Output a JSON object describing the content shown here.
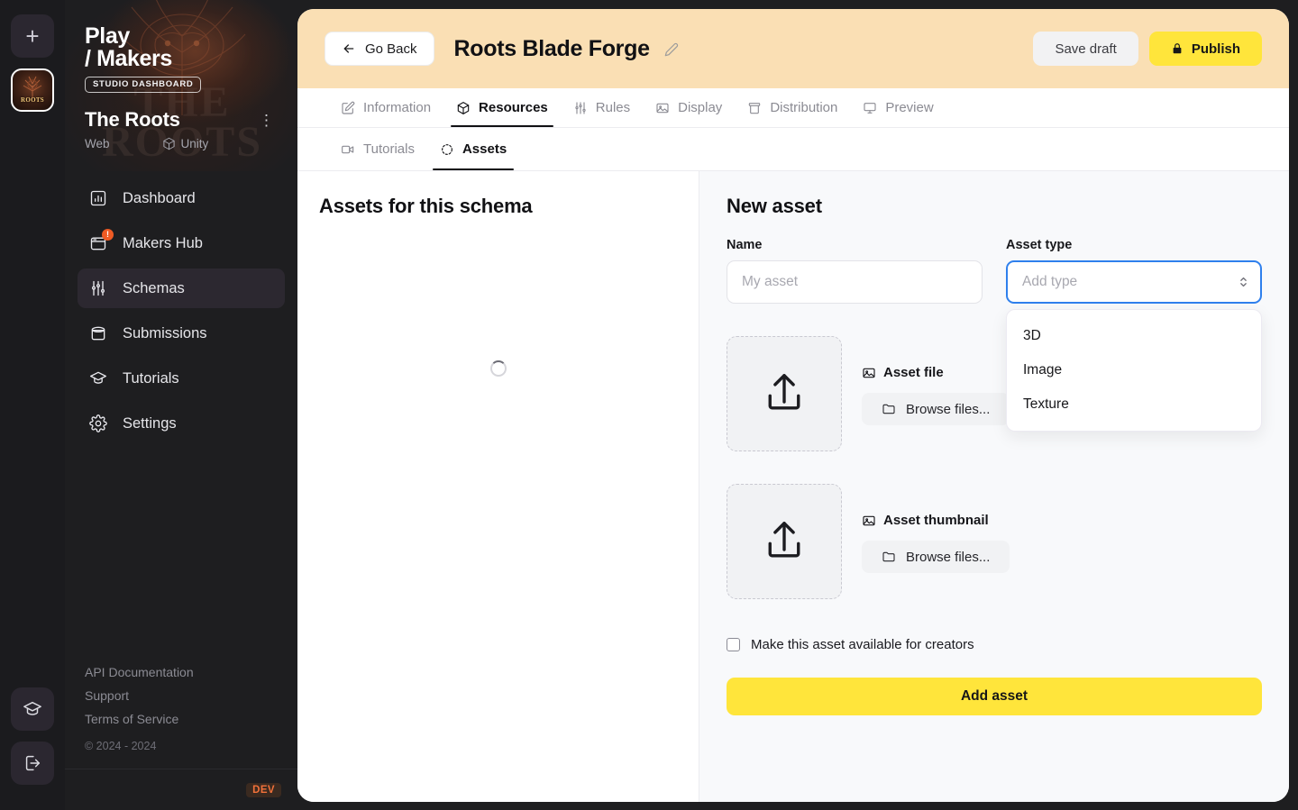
{
  "rail": {
    "add_label": "+",
    "avatar_label": "ROOTS",
    "tutorials_icon_name": "graduation-cap-icon",
    "logout_icon_name": "logout-icon"
  },
  "sidebar": {
    "brand_line1": "Play",
    "brand_line2": "/ Makers",
    "brand_badge": "STUDIO DASHBOARD",
    "ghost_text": "THE ROOTS",
    "studio_name": "The Roots",
    "kebab": "⋮",
    "platforms": [
      {
        "label": "Web",
        "icon": ""
      },
      {
        "label": "Unity",
        "icon": "cube-icon"
      }
    ],
    "items": [
      {
        "label": "Dashboard",
        "icon": "chart-bar-icon",
        "active": false,
        "badge": ""
      },
      {
        "label": "Makers Hub",
        "icon": "window-icon",
        "active": false,
        "badge": "!"
      },
      {
        "label": "Schemas",
        "icon": "sliders-icon",
        "active": true,
        "badge": ""
      },
      {
        "label": "Submissions",
        "icon": "archive-icon",
        "active": false,
        "badge": ""
      },
      {
        "label": "Tutorials",
        "icon": "graduation-cap-icon",
        "active": false,
        "badge": ""
      },
      {
        "label": "Settings",
        "icon": "gear-icon",
        "active": false,
        "badge": ""
      }
    ],
    "footer_links": [
      "API Documentation",
      "Support",
      "Terms of Service"
    ],
    "copyright": "© 2024 - 2024",
    "env_badge": "DEV"
  },
  "topbar": {
    "go_back": "Go Back",
    "title": "Roots Blade Forge",
    "edit_icon": "pencil-icon",
    "save_label": "Save draft",
    "publish_label": "Publish",
    "publish_icon": "lock-icon"
  },
  "tabs": [
    {
      "label": "Information",
      "icon": "edit-square-icon",
      "active": false
    },
    {
      "label": "Resources",
      "icon": "cube-icon",
      "active": true
    },
    {
      "label": "Rules",
      "icon": "sliders-icon",
      "active": false
    },
    {
      "label": "Display",
      "icon": "image-icon",
      "active": false
    },
    {
      "label": "Distribution",
      "icon": "archive-box-icon",
      "active": false
    },
    {
      "label": "Preview",
      "icon": "monitor-icon",
      "active": false
    }
  ],
  "subtabs": [
    {
      "label": "Tutorials",
      "icon": "video-camera-icon",
      "active": false
    },
    {
      "label": "Assets",
      "icon": "scatter-dots-icon",
      "active": true
    }
  ],
  "left_pane": {
    "heading": "Assets for this schema",
    "loading": true
  },
  "form": {
    "heading": "New asset",
    "name_label": "Name",
    "name_value": "",
    "name_placeholder": "My asset",
    "asset_type_label": "Asset type",
    "asset_type_value": "",
    "asset_type_placeholder": "Add type",
    "asset_type_options": [
      "3D",
      "Image",
      "Texture"
    ],
    "dropdown_open": true,
    "asset_file_label": "Asset file",
    "asset_file_browse": "Browse files...",
    "asset_thumbnail_label": "Asset thumbnail",
    "asset_thumbnail_browse": "Browse files...",
    "checkbox_label": "Make this asset available for creators",
    "checkbox_checked": false,
    "submit_label": "Add asset"
  },
  "colors": {
    "accent_yellow": "#ffe53b",
    "topbar_peach": "#fadfb4",
    "focus_blue": "#2f80ed",
    "badge_orange": "#ef5b24",
    "dev_orange": "#f2713a"
  }
}
